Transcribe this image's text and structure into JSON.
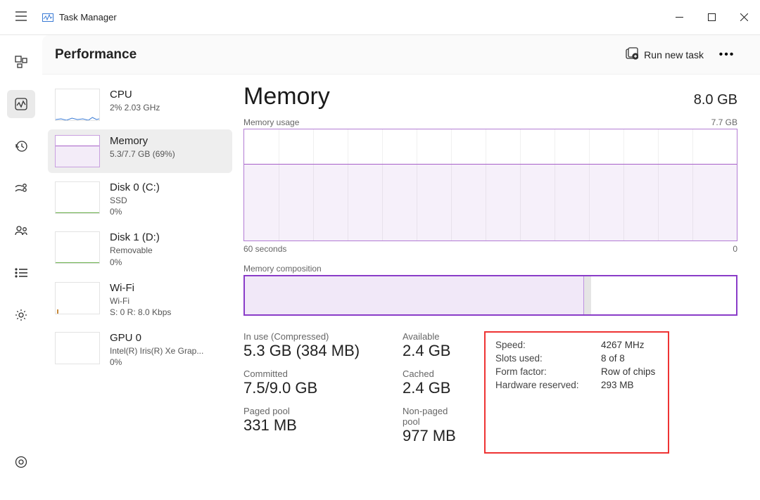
{
  "app": {
    "title": "Task Manager"
  },
  "page": {
    "title": "Performance",
    "run_task": "Run new task"
  },
  "sidebar": {
    "cpu": {
      "title": "CPU",
      "sub": "2%  2.03 GHz"
    },
    "memory": {
      "title": "Memory",
      "sub": "5.3/7.7 GB (69%)"
    },
    "disk0": {
      "title": "Disk 0 (C:)",
      "sub1": "SSD",
      "sub2": "0%"
    },
    "disk1": {
      "title": "Disk 1 (D:)",
      "sub1": "Removable",
      "sub2": "0%"
    },
    "wifi": {
      "title": "Wi-Fi",
      "sub1": "Wi-Fi",
      "sub2": "S: 0  R: 8.0 Kbps"
    },
    "gpu": {
      "title": "GPU 0",
      "sub1": "Intel(R) Iris(R) Xe Grap...",
      "sub2": "0%"
    }
  },
  "memory": {
    "heading": "Memory",
    "capacity": "8.0 GB",
    "usage_label": "Memory usage",
    "usage_max": "7.7 GB",
    "x_left": "60 seconds",
    "x_right": "0",
    "composition_label": "Memory composition",
    "stats": {
      "in_use_label": "In use (Compressed)",
      "in_use": "5.3 GB (384 MB)",
      "available_label": "Available",
      "available": "2.4 GB",
      "committed_label": "Committed",
      "committed": "7.5/9.0 GB",
      "cached_label": "Cached",
      "cached": "2.4 GB",
      "paged_label": "Paged pool",
      "paged": "331 MB",
      "nonpaged_label": "Non-paged pool",
      "nonpaged": "977 MB"
    },
    "hw": {
      "speed_k": "Speed:",
      "speed_v": "4267 MHz",
      "slots_k": "Slots used:",
      "slots_v": "8 of 8",
      "form_k": "Form factor:",
      "form_v": "Row of chips",
      "res_k": "Hardware reserved:",
      "res_v": "293 MB"
    }
  }
}
